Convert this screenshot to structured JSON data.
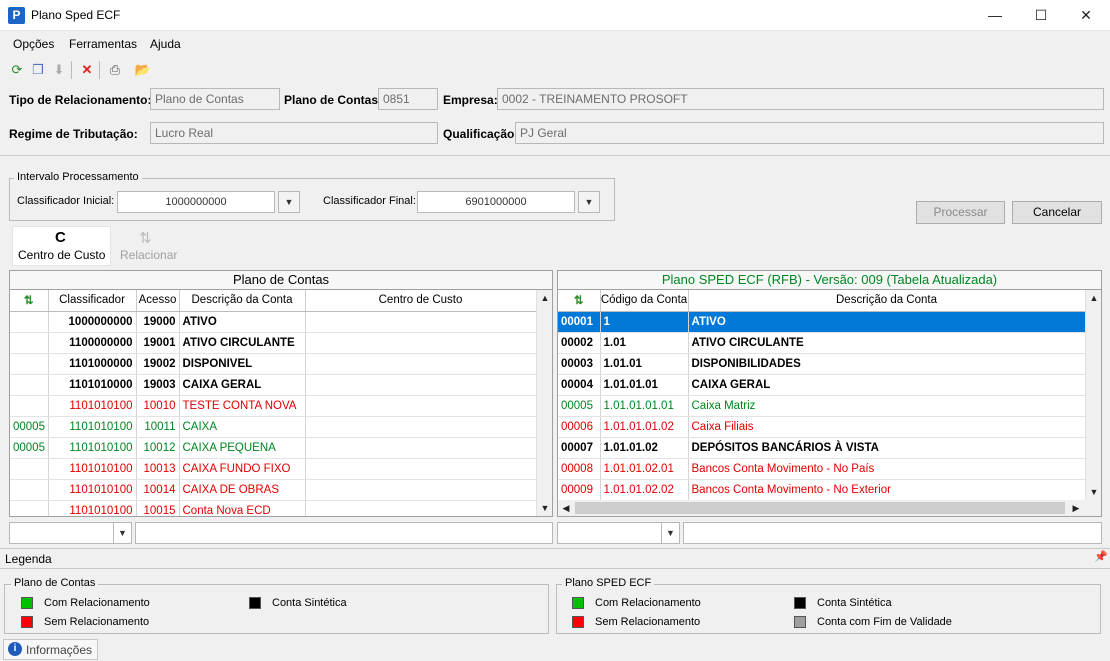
{
  "window": {
    "title": "Plano Sped ECF",
    "minimize": "—",
    "maximize": "☐",
    "close": "✕"
  },
  "menu": {
    "opcoes": "Opções",
    "ferramentas": "Ferramentas",
    "ajuda": "Ajuda"
  },
  "toolbar_icons": [
    "refresh-icon",
    "copy-icon",
    "download-icon",
    "delete-icon",
    "print-icon",
    "open-folder-icon"
  ],
  "form": {
    "tipo_label": "Tipo de Relacionamento:",
    "tipo_value": "Plano de Contas",
    "plano_label": "Plano de Contas:",
    "plano_value": "0851",
    "empresa_label": "Empresa:",
    "empresa_value": "0002 - TREINAMENTO PROSOFT",
    "regime_label": "Regime de Tributação:",
    "regime_value": "Lucro Real",
    "qualificacao_label": "Qualificação:",
    "qualificacao_value": "PJ Geral"
  },
  "intervalo": {
    "title": "Intervalo Processamento",
    "inicial_label": "Classificador Inicial:",
    "inicial_value": "1000000000",
    "final_label": "Classificador Final:",
    "final_value": "6901000000"
  },
  "buttons": {
    "processar": "Processar",
    "cancelar": "Cancelar",
    "centro_custo": "Centro de Custo",
    "centro_custo_icon": "C",
    "relacionar": "Relacionar"
  },
  "left_grid": {
    "title": "Plano de Contas",
    "headers": [
      "",
      "Classificador",
      "Acesso",
      "Descrição da Conta",
      "Centro de Custo"
    ],
    "rows": [
      {
        "style": "bold",
        "code": "",
        "classificador": "1000000000",
        "acesso": "19000",
        "descricao": "ATIVO",
        "centro": ""
      },
      {
        "style": "bold",
        "code": "",
        "classificador": "1100000000",
        "acesso": "19001",
        "descricao": "ATIVO CIRCULANTE",
        "centro": ""
      },
      {
        "style": "bold",
        "code": "",
        "classificador": "1101000000",
        "acesso": "19002",
        "descricao": "DISPONIVEL",
        "centro": ""
      },
      {
        "style": "bold",
        "code": "",
        "classificador": "1101010000",
        "acesso": "19003",
        "descricao": "CAIXA GERAL",
        "centro": ""
      },
      {
        "style": "red",
        "code": "",
        "classificador": "1101010100",
        "acesso": "10010",
        "descricao": "TESTE CONTA NOVA",
        "centro": ""
      },
      {
        "style": "green",
        "code": "00005",
        "classificador": "1101010100",
        "acesso": "10011",
        "descricao": "CAIXA",
        "centro": ""
      },
      {
        "style": "green",
        "code": "00005",
        "classificador": "1101010100",
        "acesso": "10012",
        "descricao": "CAIXA PEQUENA",
        "centro": ""
      },
      {
        "style": "red",
        "code": "",
        "classificador": "1101010100",
        "acesso": "10013",
        "descricao": "CAIXA FUNDO FIXO",
        "centro": ""
      },
      {
        "style": "red",
        "code": "",
        "classificador": "1101010100",
        "acesso": "10014",
        "descricao": "CAIXA DE OBRAS",
        "centro": ""
      },
      {
        "style": "red",
        "code": "",
        "classificador": "1101010100",
        "acesso": "10015",
        "descricao": "Conta Nova ECD",
        "centro": ""
      }
    ]
  },
  "right_grid": {
    "title": "Plano SPED ECF (RFB) - Versão: 009 (Tabela Atualizada)",
    "headers": [
      "",
      "Código da Conta",
      "Descrição da Conta"
    ],
    "rows": [
      {
        "style": "sel",
        "id": "00001",
        "codigo": "1",
        "descricao": "ATIVO"
      },
      {
        "style": "bold",
        "id": "00002",
        "codigo": "1.01",
        "descricao": "ATIVO CIRCULANTE"
      },
      {
        "style": "bold",
        "id": "00003",
        "codigo": "1.01.01",
        "descricao": "DISPONIBILIDADES"
      },
      {
        "style": "bold",
        "id": "00004",
        "codigo": "1.01.01.01",
        "descricao": "CAIXA GERAL"
      },
      {
        "style": "green",
        "id": "00005",
        "codigo": "1.01.01.01.01",
        "descricao": "Caixa Matriz"
      },
      {
        "style": "red",
        "id": "00006",
        "codigo": "1.01.01.01.02",
        "descricao": "Caixa Filiais"
      },
      {
        "style": "bold",
        "id": "00007",
        "codigo": "1.01.01.02",
        "descricao": "DEPÓSITOS BANCÁRIOS À VISTA"
      },
      {
        "style": "red",
        "id": "00008",
        "codigo": "1.01.01.02.01",
        "descricao": "Bancos Conta Movimento - No País"
      },
      {
        "style": "red",
        "id": "00009",
        "codigo": "1.01.01.02.02",
        "descricao": "Bancos Conta Movimento - No Exterior"
      }
    ]
  },
  "legenda": {
    "title": "Legenda",
    "left_title": "Plano de Contas",
    "right_title": "Plano SPED ECF",
    "com_rel": "Com Relacionamento",
    "sem_rel": "Sem Relacionamento",
    "sintetica": "Conta Sintética",
    "fim_validade": "Conta com Fim de Validade",
    "colors": {
      "green": "#00c000",
      "red": "#ff0000",
      "black": "#000000",
      "gray": "#a0a0a0"
    }
  },
  "status": {
    "informacoes": "Informações"
  }
}
